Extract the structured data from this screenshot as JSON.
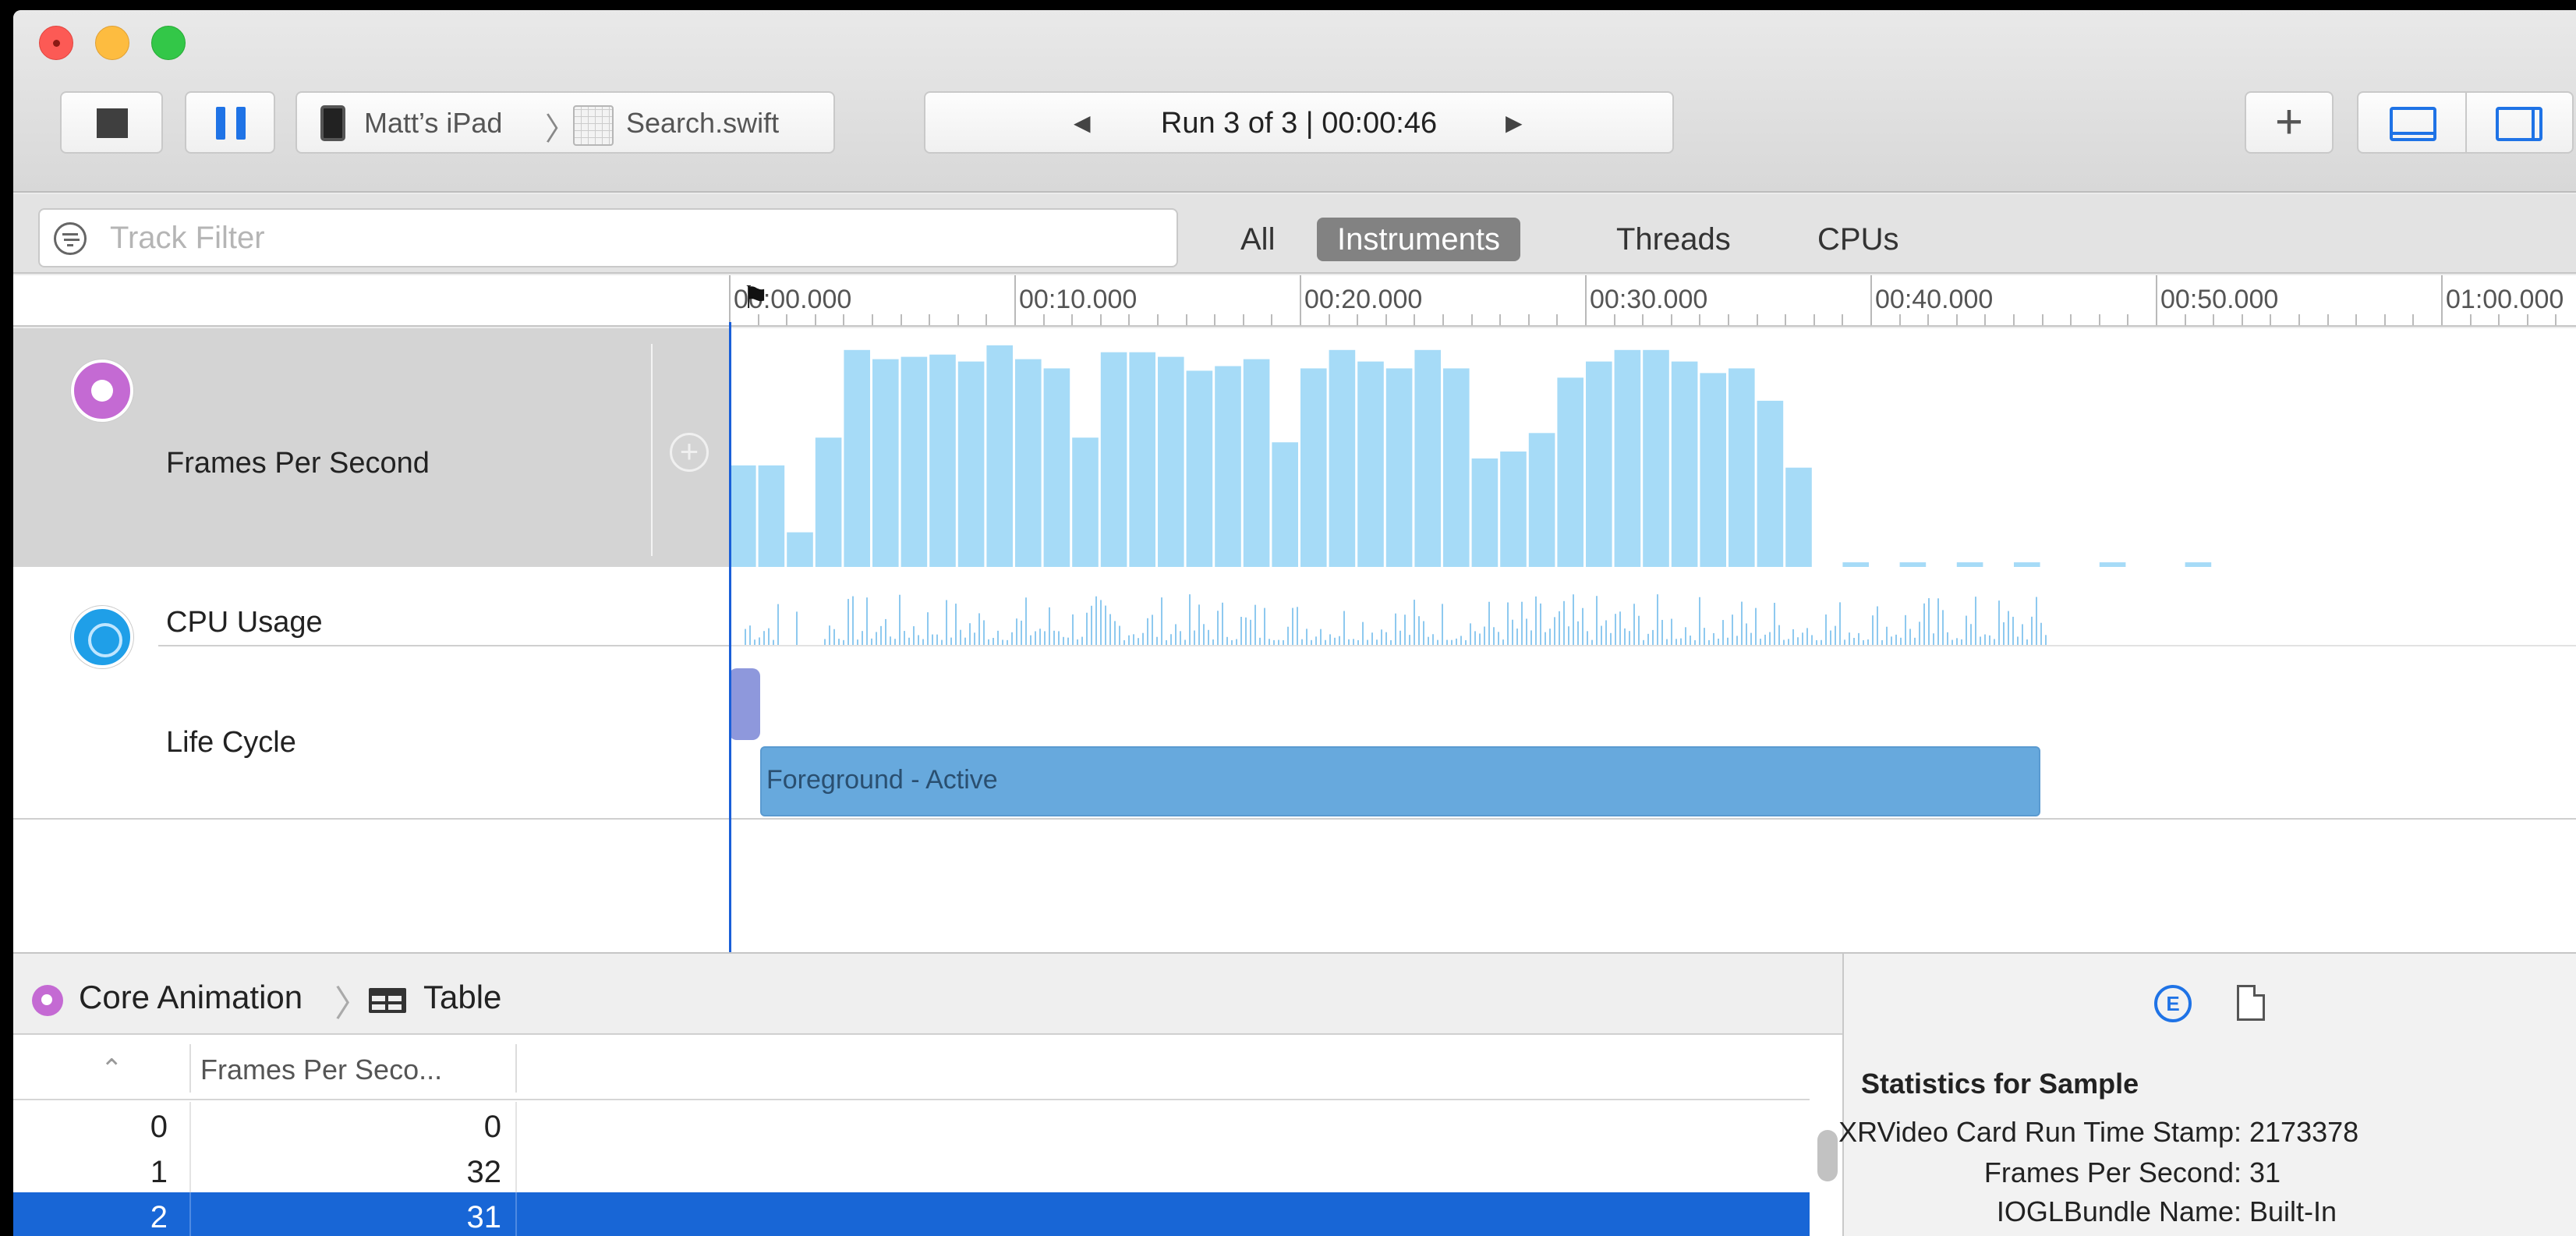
{
  "toolbar": {
    "device": "Matt’s iPad",
    "target": "Search.swift",
    "run_label": "Run 3 of 3  |  00:00:46",
    "prev_arrow": "◀",
    "next_arrow": "▶",
    "add_label": "+"
  },
  "filter": {
    "placeholder": "Track Filter",
    "scopes": [
      "All",
      "Instruments",
      "Threads",
      "CPUs"
    ],
    "active_scope": "Instruments"
  },
  "timeline": {
    "ticks": [
      "00:00.000",
      "00:10.000",
      "00:20.000",
      "00:30.000",
      "00:40.000",
      "00:50.000",
      "01:00.000"
    ]
  },
  "tracks": {
    "fps": "Frames Per Second",
    "cpu": "CPU Usage",
    "lifecycle": "Life Cycle",
    "lifecycle_state": "Foreground - Active"
  },
  "detail": {
    "instrument": "Core Animation",
    "view": "Table",
    "column_header": "Frames Per Seco...",
    "rows": [
      {
        "index": "0",
        "value": "0"
      },
      {
        "index": "1",
        "value": "32"
      },
      {
        "index": "2",
        "value": "31"
      }
    ],
    "selected_row": 2
  },
  "inspector": {
    "title": "Statistics for Sample",
    "stats": [
      {
        "key": "XRVideo Card Run Time Stamp:",
        "value": "2173378"
      },
      {
        "key": "Frames Per Second:",
        "value": "31"
      },
      {
        "key": "IOGLBundle Name:",
        "value": "Built-In"
      }
    ]
  },
  "colors": {
    "accent": "#1f73e6",
    "selection": "#1866d6",
    "fps_bar": "#a6dbf7",
    "cpu_bar": "#8ec9ef",
    "lifecycle": "#67a9dd"
  },
  "chart_data": {
    "type": "bar",
    "fps_values": [
      44,
      44,
      15,
      56,
      94,
      90,
      91,
      92,
      89,
      96,
      90,
      86,
      56,
      93,
      93,
      91,
      85,
      87,
      90,
      54,
      86,
      94,
      89,
      86,
      94,
      86,
      47,
      50,
      58,
      82,
      89,
      94,
      94,
      89,
      84,
      86,
      72,
      43,
      0,
      2,
      0,
      2,
      0,
      2,
      0,
      2,
      0,
      0,
      2,
      0,
      0,
      2,
      0,
      0,
      0,
      0,
      0,
      0,
      0,
      0,
      0,
      0,
      0,
      0
    ]
  }
}
